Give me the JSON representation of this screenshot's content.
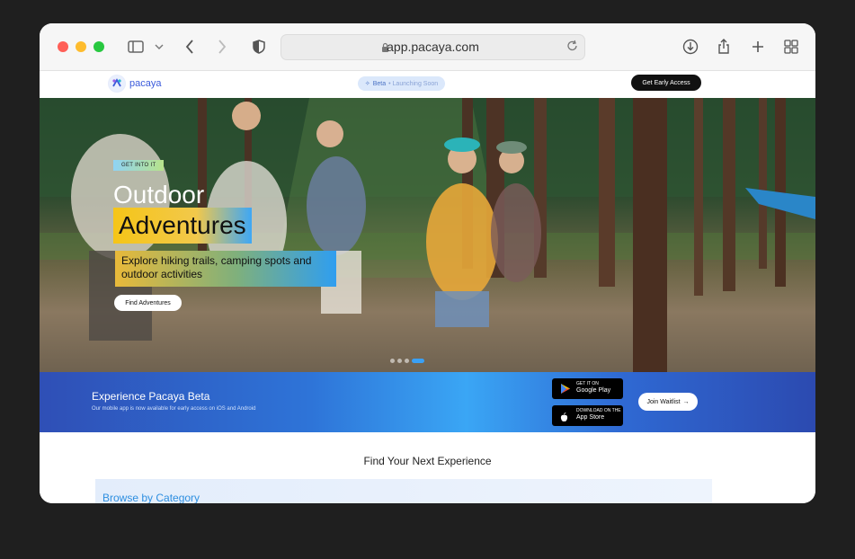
{
  "browser": {
    "url": "app.pacaya.com",
    "icons": [
      "sidebar-icon",
      "chevron-down-icon",
      "back-icon",
      "forward-icon",
      "shield-icon",
      "lock-icon",
      "reload-icon",
      "download-icon",
      "share-icon",
      "new-tab-icon",
      "tab-overview-icon"
    ]
  },
  "nav": {
    "logo_text": "pacaya",
    "beta_label": "Beta",
    "beta_suffix": "• Launching Soon",
    "cta": "Get Early Access"
  },
  "hero": {
    "tag": "GET INTO IT",
    "title_line1": "Outdoor",
    "title_line2": "Adventures",
    "subtitle": "Explore hiking trails, camping spots and outdoor activities",
    "button": "Find Adventures",
    "slides": 4,
    "active_slide": 4
  },
  "banner": {
    "title": "Experience Pacaya Beta",
    "subtitle": "Our mobile app is now available for early access on iOS and Android",
    "google_small": "GET IT ON",
    "google_big": "Google Play",
    "apple_small": "DOWNLOAD ON THE",
    "apple_big": "App Store",
    "waitlist": "Join Waitlist",
    "arrow": "→"
  },
  "main": {
    "section_title": "Find Your Next Experience",
    "browse_title": "Browse by Category"
  },
  "colors": {
    "accent": "#3aa0f5",
    "brand": "#3b5bdb",
    "highlight": "#f5c518"
  }
}
